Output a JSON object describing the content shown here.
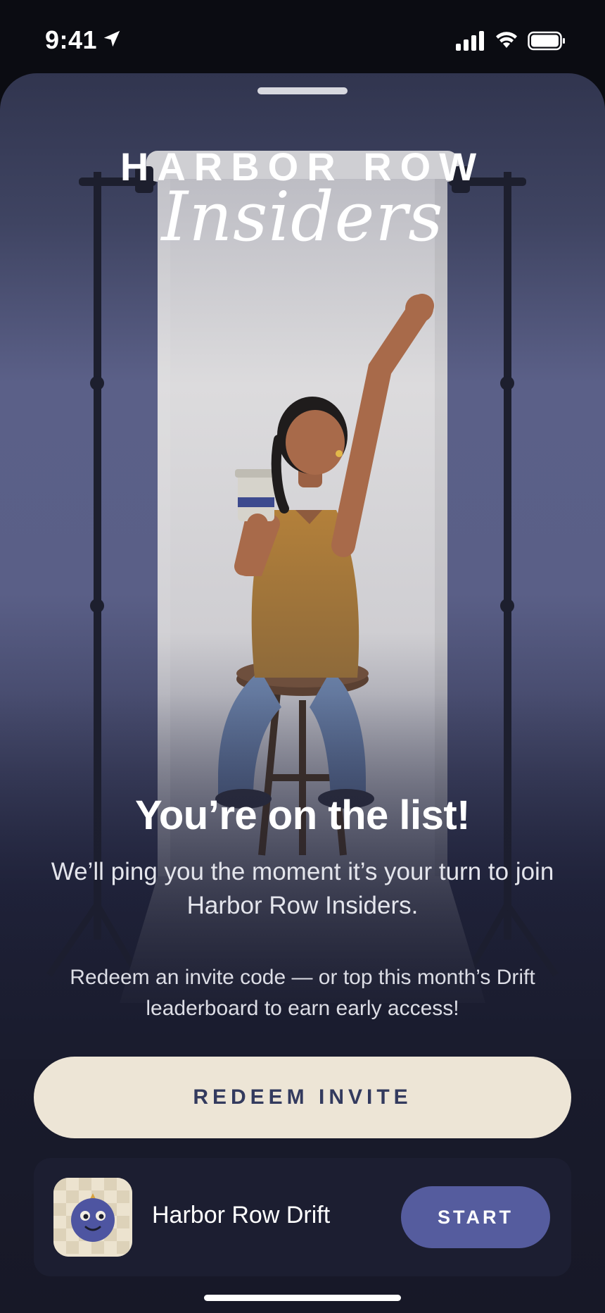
{
  "status_bar": {
    "time": "9:41",
    "icons": [
      "location-arrow-icon",
      "cellular-signal-icon",
      "wifi-icon",
      "battery-icon"
    ]
  },
  "hero": {
    "brand_top": "HARBOR ROW",
    "brand_script": "Insiders",
    "illustration": "person-on-stool-holding-coffee-raising-arm"
  },
  "message": {
    "headline": "You’re on the list!",
    "body": "We’ll ping you the moment it’s your turn to join Harbor Row Insiders.",
    "secondary": "Redeem an invite code — or top this month’s Drift leaderboard to earn early access!"
  },
  "actions": {
    "redeem_label": "REDEEM INVITE"
  },
  "promo": {
    "app_name": "Harbor Row Drift",
    "start_label": "START",
    "icon": "drift-mascot-icon"
  },
  "colors": {
    "redeem_bg": "#ede5d6",
    "redeem_text": "#333a5e",
    "start_bg": "#555c9e",
    "card_bg": "#1c1e31"
  }
}
